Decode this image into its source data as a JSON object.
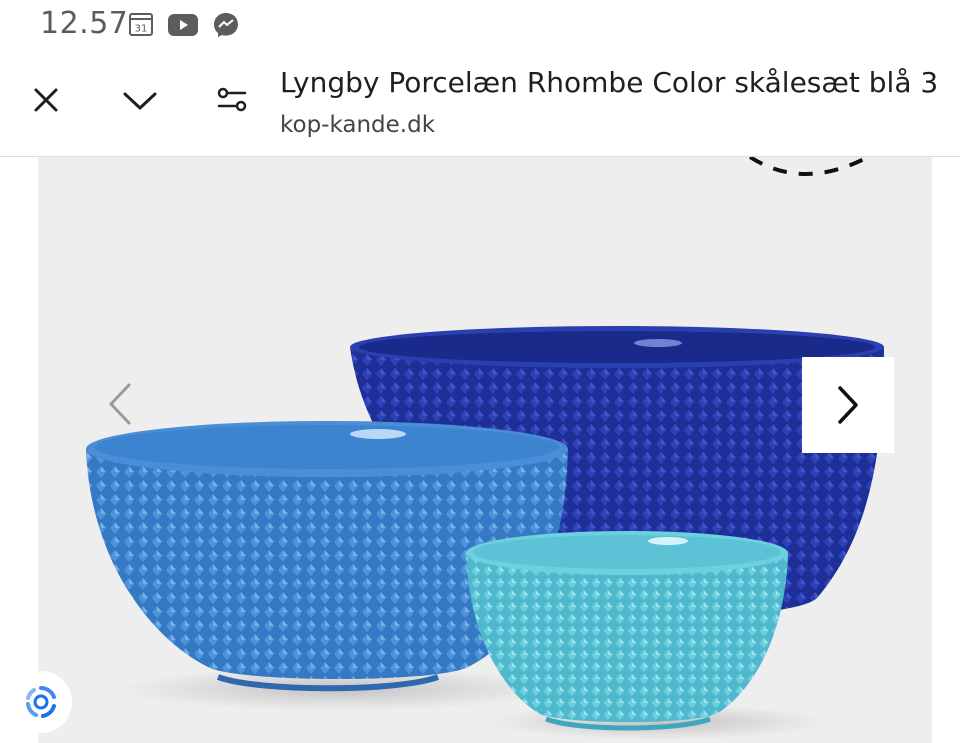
{
  "status_bar": {
    "time": "12.57",
    "calendar_day": "31",
    "icons": [
      "calendar-icon",
      "youtube-icon",
      "messenger-icon"
    ]
  },
  "toolbar": {
    "title": "Lyngby Porcelæn Rhombe Color skålesæt blå 3",
    "url": "kop-kande.dk",
    "icons": [
      "close-icon",
      "chevron-down-icon",
      "tune-icon"
    ]
  },
  "product_gallery": {
    "image_subject": "three blue rhombe-patterned bowls",
    "prev_icon": "chevron-left-icon",
    "next_icon": "chevron-right-icon",
    "fab_icon": "google-lens-icon"
  },
  "colors": {
    "dark_blue": "#1e2f9a",
    "mid_blue": "#3f86cf",
    "turquoise": "#5cc3d6",
    "background": "#eeeeee"
  }
}
